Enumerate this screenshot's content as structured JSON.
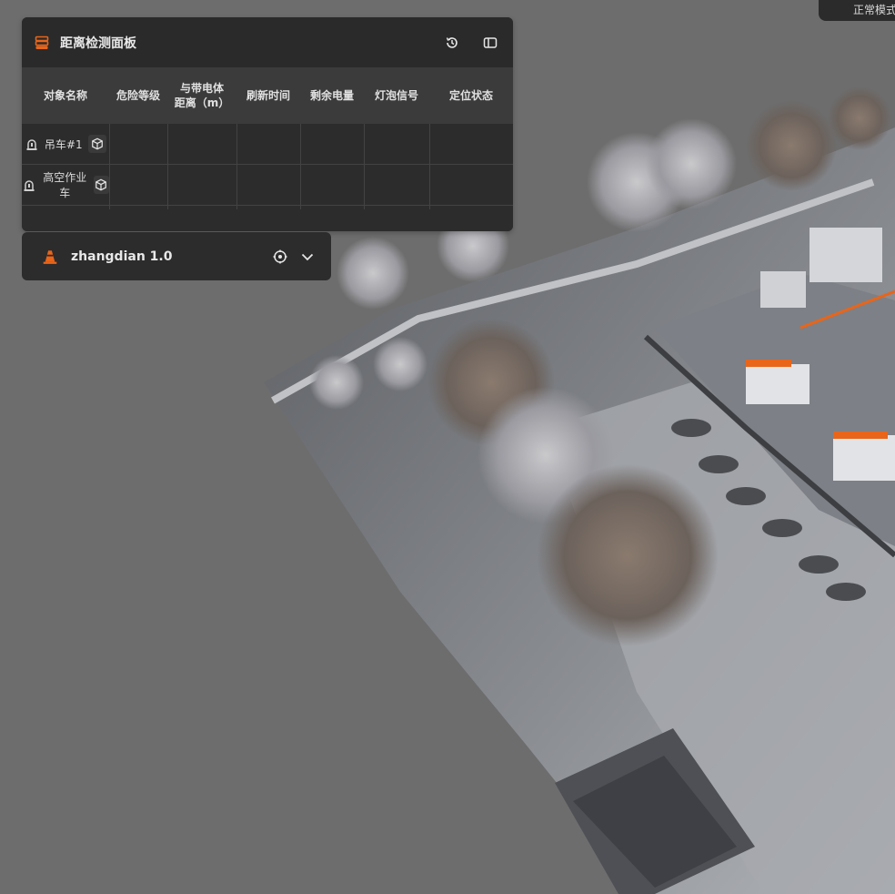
{
  "mode_tab": {
    "label": "正常模式"
  },
  "distance_panel": {
    "title": "距离检测面板",
    "accent_color": "#e8651a",
    "columns": [
      "对象名称",
      "危险等级",
      "与带电体",
      "距离（m）",
      "刷新时间",
      "剩余电量",
      "灯泡信号",
      "定位状态"
    ],
    "rows": [
      {
        "name": "吊车#1",
        "danger": "",
        "distance": "",
        "refresh": "",
        "battery": "",
        "signal": "",
        "location": ""
      },
      {
        "name": "高空作业车",
        "danger": "",
        "distance": "",
        "refresh": "",
        "battery": "",
        "signal": "",
        "location": ""
      }
    ],
    "icons": {
      "title": "server-stack-icon",
      "history": "history-icon",
      "collapse": "sidebar-toggle-icon",
      "object": "alarm-light-icon",
      "locate": "cube-icon"
    }
  },
  "model_panel": {
    "name": "zhangdian 1.0",
    "icons": {
      "model": "traffic-cone-icon",
      "focus": "crosshair-icon",
      "expand": "chevron-down-icon"
    }
  },
  "scene": {
    "background_color": "#6d6d6d",
    "description_icon": "pointcloud-substation"
  }
}
